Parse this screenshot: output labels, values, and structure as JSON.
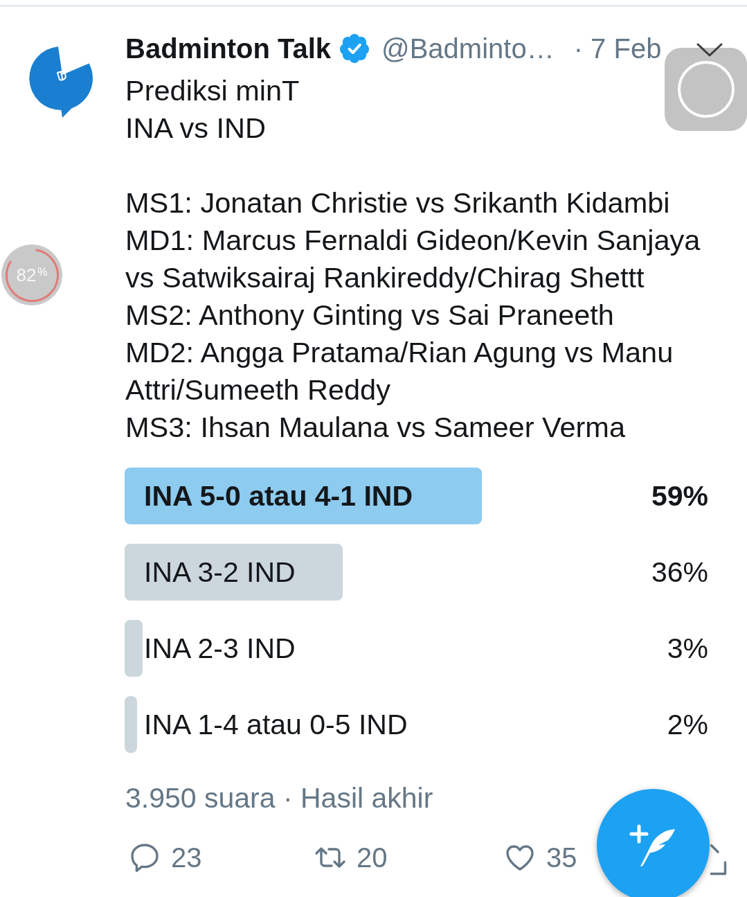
{
  "tweet": {
    "author": {
      "name": "Badminton Talk",
      "verified": true,
      "handle": "@Badminto…",
      "date": "· 7 Feb"
    },
    "paragraphs": [
      "Prediksi minT\nINA vs IND",
      "MS1: Jonatan Christie vs Srikanth Kidambi\nMD1: Marcus Fernaldi Gideon/Kevin Sanjaya vs Satwiksairaj Rankireddy/Chirag Shettt\nMS2: Anthony Ginting vs Sai Praneeth\nMD2: Angga Pratama/Rian Agung vs Manu Attri/Sumeeth Reddy\nMS3: Ihsan Maulana vs Sameer Verma"
    ],
    "poll": {
      "options": [
        {
          "label": "INA 5-0 atau 4-1 IND",
          "percent": "59%",
          "level": 0.59,
          "winner": true
        },
        {
          "label": "INA 3-2 IND",
          "percent": "36%",
          "level": 0.36,
          "winner": false
        },
        {
          "label": "INA 2-3 IND",
          "percent": "3%",
          "level": 0.03,
          "winner": false
        },
        {
          "label": "INA 1-4 atau 0-5 IND",
          "percent": "2%",
          "level": 0.02,
          "winner": false
        }
      ],
      "summary": "3.950 suara · Hasil akhir"
    },
    "actions": [
      {
        "kind": "reply",
        "count": "23"
      },
      {
        "kind": "retweet",
        "count": "20"
      },
      {
        "kind": "like",
        "count": "35"
      },
      {
        "kind": "share"
      }
    ]
  },
  "overlays": {
    "progress_widget": {
      "value": "82",
      "unit": "%"
    }
  }
}
